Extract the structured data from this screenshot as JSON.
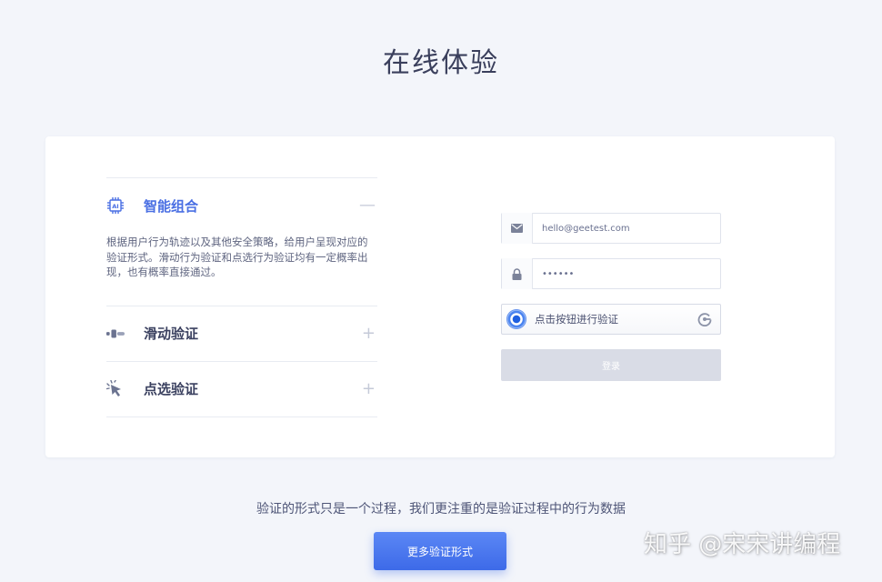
{
  "page": {
    "title": "在线体验"
  },
  "accordion": {
    "items": [
      {
        "label": "智能组合",
        "icon": "ai-chip-icon",
        "toggle": "—",
        "expanded": true,
        "description": "根据用户行为轨迹以及其他安全策略，给用户呈现对应的验证形式。滑动行为验证和点选行为验证均有一定概率出现，也有概率直接通过。"
      },
      {
        "label": "滑动验证",
        "icon": "slider-icon",
        "toggle": "+",
        "expanded": false
      },
      {
        "label": "点选验证",
        "icon": "click-cursor-icon",
        "toggle": "+",
        "expanded": false
      }
    ]
  },
  "form": {
    "email": {
      "value": "hello@geetest.com",
      "icon": "mail-icon"
    },
    "password": {
      "value": "••••••",
      "icon": "lock-icon"
    },
    "captcha": {
      "label": "点击按钮进行验证",
      "icon": "geetest-logo-icon"
    },
    "login_label": "登录"
  },
  "footer": {
    "caption": "验证的形式只是一个过程，我们更注重的是验证过程中的行为数据",
    "more_label": "更多验证形式"
  },
  "watermark": "知乎 @宋宋讲编程",
  "colors": {
    "accent": "#4a6fe3",
    "button": "#3d6ae8",
    "disabled": "#d9dce6",
    "background": "#f3f5fa"
  }
}
